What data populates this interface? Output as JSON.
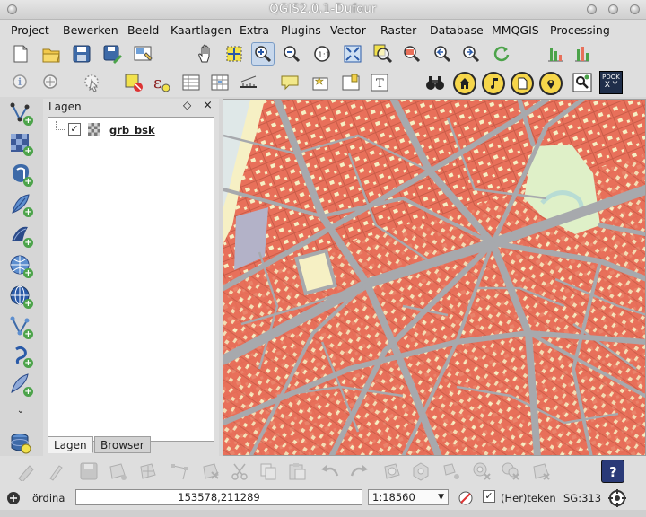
{
  "window": {
    "title": "QGIS2.0.1-Dufour"
  },
  "menu": {
    "items": [
      "Project",
      "Bewerken",
      "Beeld",
      "Kaartlagen",
      "Extra",
      "Plugins",
      "Vector",
      "Raster",
      "Database",
      "MMQGIS",
      "Processing"
    ]
  },
  "toolbar1": {
    "icons": [
      "new-project-icon",
      "open-project-icon",
      "save-project-icon",
      "save-as-icon",
      "print-composer-icon",
      "pan-icon",
      "pan-to-selection-icon",
      "zoom-in-icon",
      "zoom-out-icon",
      "zoom-actual-size-icon",
      "zoom-full-icon",
      "zoom-to-selection-icon",
      "zoom-to-layer-icon",
      "zoom-last-icon",
      "zoom-next-icon",
      "refresh-icon",
      "histogram-icon"
    ]
  },
  "toolbar2": {
    "icons": [
      "identify-icon",
      "select-icon",
      "select-polygon-icon",
      "deselect-icon",
      "expression-icon",
      "attribute-table-icon",
      "field-calculator-icon",
      "measure-icon",
      "map-tips-icon",
      "bookmark-icon",
      "text-annotation-icon",
      "binoculars-icon",
      "home-icon",
      "music-note-icon",
      "document-icon",
      "location-pin-icon",
      "search-icon"
    ],
    "pdok_label_line1": "PDOK",
    "pdok_label_line2": "X Y"
  },
  "left_toolbar": {
    "icons": [
      "digitize-vector-icon",
      "add-raster-icon",
      "add-postgis-icon",
      "add-spatialite-icon",
      "add-mssql-icon",
      "add-wms-icon",
      "add-wcs-icon",
      "add-wfs-icon",
      "add-delimited-text-icon",
      "new-layer-icon",
      "more-icon",
      "gps-database-icon"
    ]
  },
  "layers_panel": {
    "title": "Lagen",
    "float_glyph": "◇",
    "close_glyph": "×",
    "layers": [
      {
        "name": "grb_bsk",
        "checked": true,
        "check_glyph": "✓"
      }
    ],
    "tabs": [
      "Lagen",
      "Browser"
    ],
    "active_tab": "Lagen"
  },
  "map": {
    "colors": {
      "background": "#f6f0c4",
      "buildings": "#e8705a",
      "roads": "#a7a9ad",
      "park": "#dff0c8",
      "water": "#b3b2c8"
    }
  },
  "bottom_toolbar": {
    "icons": [
      "current-edits-icon",
      "toggle-editing-icon",
      "save-edits-icon",
      "add-feature-icon",
      "move-feature-icon",
      "node-tool-icon",
      "delete-selected-icon",
      "cut-icon",
      "copy-icon",
      "paste-icon",
      "undo-icon",
      "redo-icon",
      "simplify-icon",
      "add-ring-icon",
      "add-part-icon",
      "delete-ring-icon",
      "delete-part-icon",
      "reshape-icon",
      "split-icon",
      "merge-icon",
      "help-icon"
    ]
  },
  "statusbar": {
    "coordinate_label": "ördina",
    "coordinate_value": "153578,211289",
    "scale_value": "1:18560",
    "render_label": "(Her)teken",
    "render_checked": true,
    "check_glyph": "✓",
    "crs_label": "SG:313"
  }
}
